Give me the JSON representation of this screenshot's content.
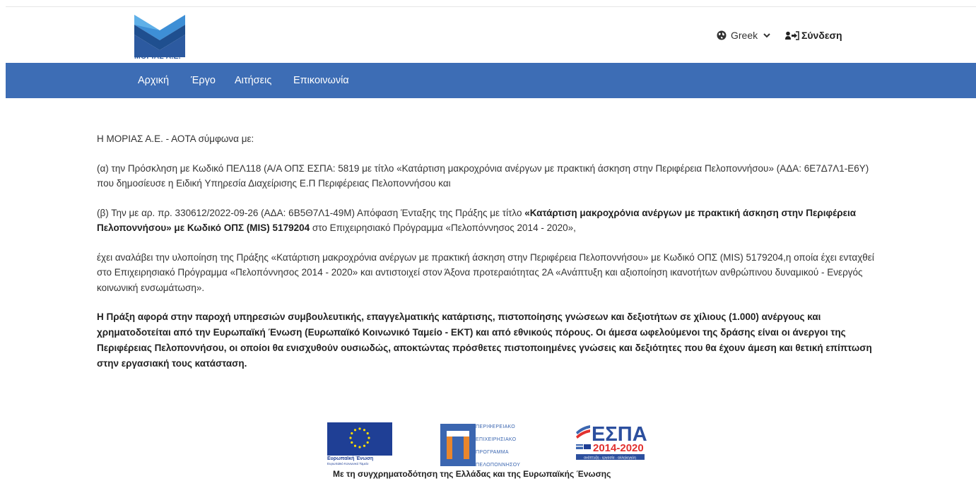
{
  "header": {
    "logo_text": "ΜΟΡΙΑΣ Α.Ε.",
    "language": {
      "label": "Greek",
      "icon": "globe-icon"
    },
    "login": {
      "label": "Σύνδεση",
      "icon": "user-login-icon"
    }
  },
  "nav": {
    "items": [
      {
        "label": "Αρχική"
      },
      {
        "label": "Έργο"
      },
      {
        "label": "Αιτήσεις"
      },
      {
        "label": "Επικοινωνία"
      }
    ]
  },
  "content": {
    "intro": "Η ΜΟΡΙΑΣ Α.Ε. - ΑΟΤΑ σύμφωνα με:",
    "para_a": "(α) την Πρόσκληση με Κωδικό ΠΕΛ118 (Α/Α ΟΠΣ ΕΣΠΑ: 5819 με τίτλο «Κατάρτιση μακροχρόνια ανέργων με πρακτική άσκηση στην Περιφέρεια Πελοποννήσου» (ΑΔΑ: 6Ε7Δ7Λ1-Ε6Υ) που δημοσίευσε η Ειδική Υπηρεσία Διαχείρισης Ε.Π Περιφέρειας Πελοποννήσου και",
    "para_b_pre": "(β) Την με αρ. πρ. 330612/2022-09-26 (ΑΔΑ: 6Β5Θ7Λ1-49Μ) Απόφαση Ένταξης της Πράξης με τίτλο ",
    "para_b_bold": "«Κατάρτιση μακροχρόνια ανέργων με πρακτική άσκηση στην Περιφέρεια Πελοποννήσου» με Κωδικό ΟΠΣ (MIS) 5179204",
    "para_b_post": " στο Επιχειρησιακό Πρόγραμμα «Πελοπόννησος 2014 - 2020»,",
    "para_c": "έχει αναλάβει την υλοποίηση της Πράξης «Κατάρτιση μακροχρόνια ανέργων με πρακτική άσκηση στην Περιφέρεια Πελοποννήσου» με Κωδικό ΟΠΣ (MIS) 5179204,η οποία έχει ενταχθεί στο Επιχειρησιακό Πρόγραμμα «Πελοπόννησος 2014 - 2020» και αντιστοιχεί στον Άξονα προτεραιότητας 2Α «Ανάπτυξη και αξιοποίηση ικανοτήτων ανθρώπινου δυναμικού - Ενεργός κοινωνική ενσωμάτωση».",
    "para_d": "Η Πράξη αφορά στην παροχή υπηρεσιών συμβουλευτικής, επαγγελματικής κατάρτισης, πιστοποίησης γνώσεων και δεξιοτήτων σε χίλιους (1.000) ανέργους και χρηματοδοτείται από την Ευρωπαϊκή Ένωση (Ευρωπαϊκό Κοινωνικό Ταμείο - ΕΚΤ) και από εθνικούς πόρους. Οι άμεσα ωφελούμενοι της δράσης είναι οι άνεργοι της Περιφέρειας Πελοποννήσου, οι οποίοι θα ενισχυθούν ουσιωδώς, αποκτώντας πρόσθετες πιστοποιημένες γνώσεις και δεξιότητες που θα έχουν άμεση και θετική επίπτωση στην εργασιακή τους κατάσταση."
  },
  "footer": {
    "eu_label": "Ευρωπαϊκή Ένωση",
    "eu_sublabel": "Ευρωπαϊκό Κοινωνικό Ταμείο",
    "pep_lines": [
      "ΠΕΡΙΦΕΡΕΙΑΚΟ",
      "ΕΠΙΧΕΙΡΗΣΙΑΚΟ",
      "ΠΡΟΓΡΑΜΜΑ",
      "ΠΕΛΟΠΟΝΝΗΣΟΥ"
    ],
    "espa_title": "ΕΣΠΑ",
    "espa_years": "2014-2020",
    "espa_tagline": "ανάπτυξη - εργασία - αλληλεγγύη",
    "funding_text": "Με τη συγχρηματοδότηση της Ελλάδας και της Ευρωπαϊκής Ένωσης"
  },
  "colors": {
    "navbar": "#3d6db5",
    "brand_blue": "#2c5aa0",
    "eu_blue": "#1f3f95",
    "espa_red": "#e2312f"
  }
}
